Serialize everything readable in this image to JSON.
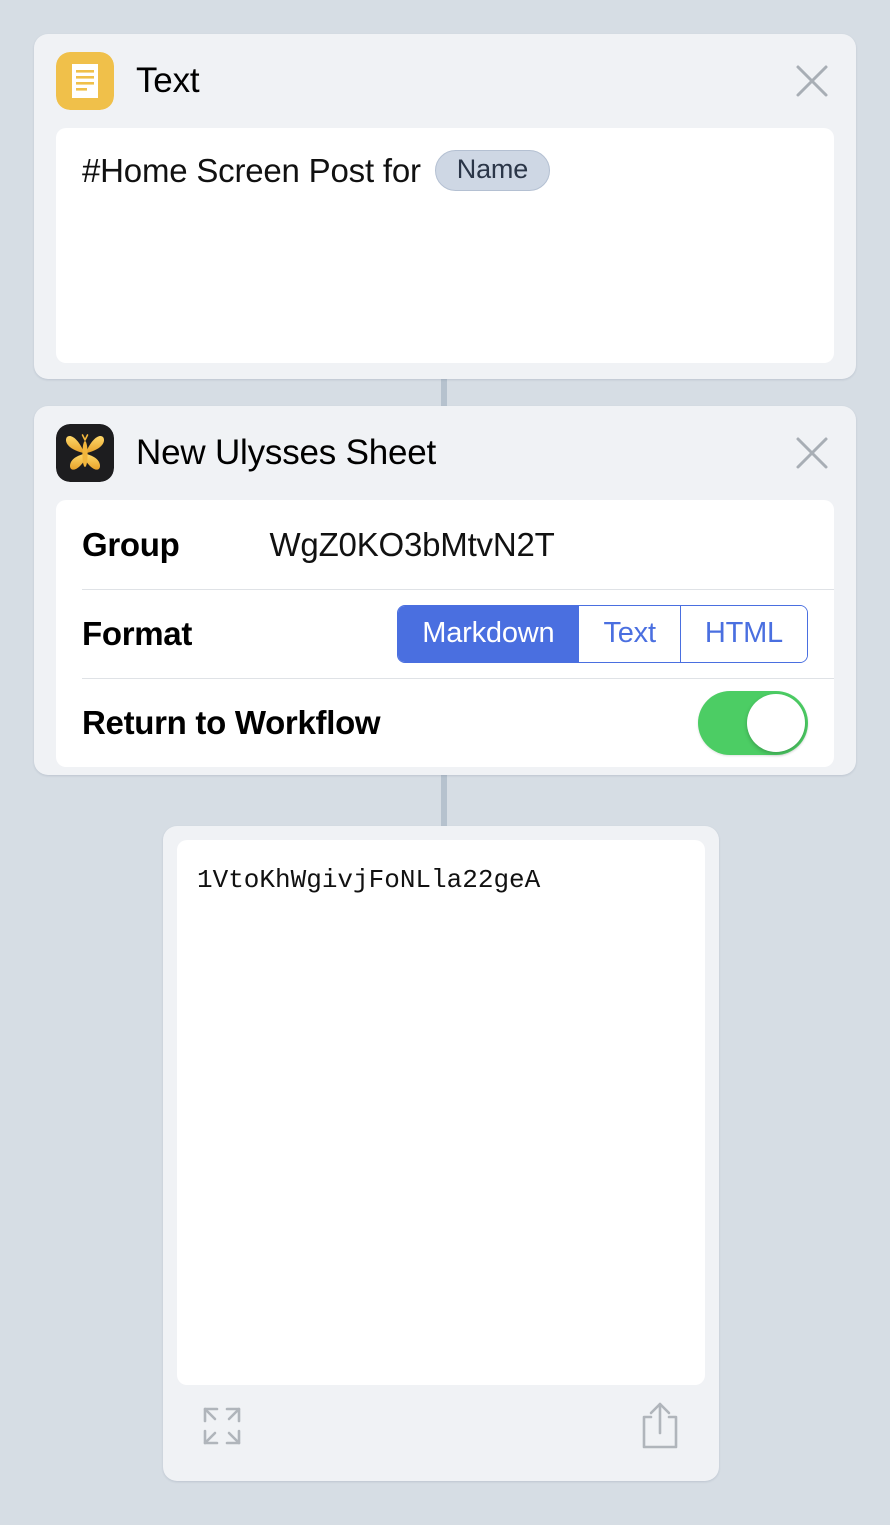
{
  "background_color": "#d6dde4",
  "connector_color": "#b6c2ce",
  "cards": {
    "text_action": {
      "icon_name": "text-document-icon",
      "icon_color": "#f0c04a",
      "title": "Text",
      "close_label": "Close",
      "content_prefix": "#Home Screen Post for",
      "token_label": "Name"
    },
    "ulysses_action": {
      "icon_name": "ulysses-butterfly-icon",
      "icon_color": "#f3b840",
      "title": "New Ulysses Sheet",
      "close_label": "Close",
      "rows": {
        "group": {
          "label": "Group",
          "value": "WgZ0KO3bMtvN2T"
        },
        "format": {
          "label": "Format",
          "options": [
            "Markdown",
            "Text",
            "HTML"
          ],
          "selected": "Markdown",
          "accent_color": "#4a6fe0"
        },
        "return_to_workflow": {
          "label": "Return to Workflow",
          "enabled": true,
          "on_color": "#4ccd64"
        }
      }
    },
    "result": {
      "value": "1VtoKhWgivjFoNLla22geA",
      "expand_label": "Expand",
      "share_label": "Share"
    }
  }
}
